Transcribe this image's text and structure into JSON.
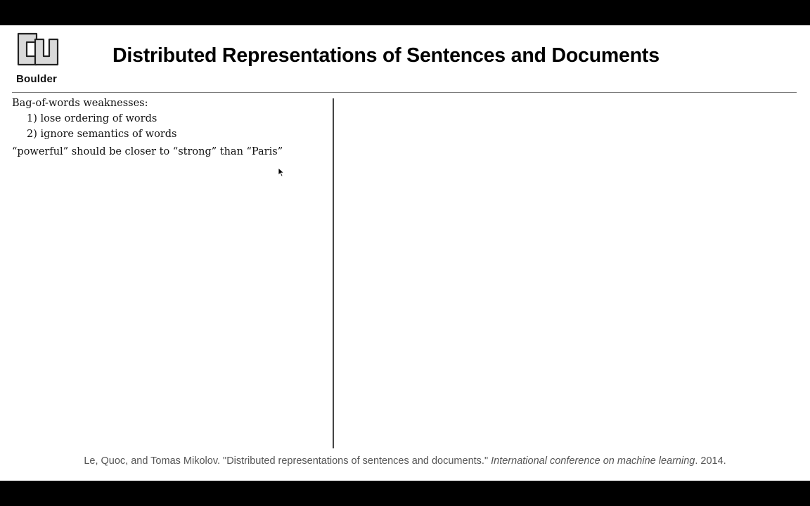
{
  "header": {
    "logo_text": "Boulder",
    "title": "Distributed Representations of Sentences and Documents"
  },
  "left_column": {
    "heading": "Bag-of-words weaknesses:",
    "items": [
      "1) lose ordering of words",
      "2) ignore semantics of words"
    ],
    "note": "“powerful” should be closer to “strong” than “Paris”"
  },
  "footer": {
    "citation_prefix": "Le, Quoc, and Tomas Mikolov. \"Distributed representations of sentences and documents.\"",
    "citation_venue": "International conference on machine learning",
    "citation_suffix": ". 2014."
  },
  "colors": {
    "background": "#ffffff",
    "letterbox": "#000000",
    "text": "#111111",
    "footer_text": "#555555"
  },
  "icons": {
    "logo": "cu-logo-icon",
    "cursor": "mouse-pointer-icon"
  }
}
